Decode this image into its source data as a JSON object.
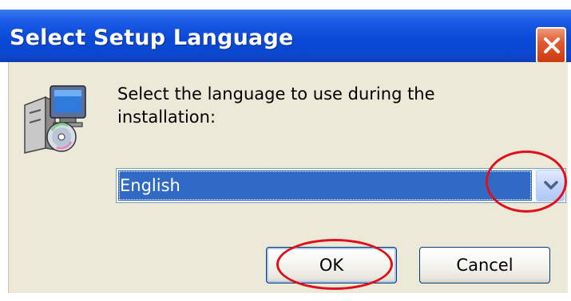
{
  "window": {
    "title": "Select Setup Language"
  },
  "icons": {
    "close": "close-icon",
    "setup": "setup-installer-icon",
    "dropdown": "chevron-down-icon"
  },
  "prompt": {
    "line1": "Select the language to use during the",
    "line2": "installation:"
  },
  "language_select": {
    "selected": "English"
  },
  "buttons": {
    "ok": "OK",
    "cancel": "Cancel"
  },
  "colors": {
    "titlebar": "#0a4ad8",
    "selection": "#316ac5",
    "annotation": "#e0101a",
    "dialog_bg": "#ece9d8"
  }
}
